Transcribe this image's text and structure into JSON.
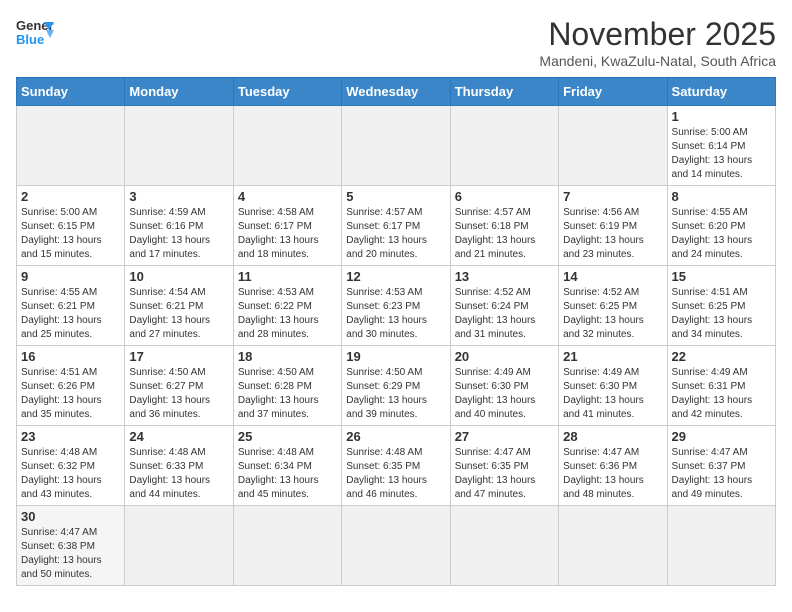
{
  "logo": {
    "text_general": "General",
    "text_blue": "Blue"
  },
  "title": "November 2025",
  "location": "Mandeni, KwaZulu-Natal, South Africa",
  "weekdays": [
    "Sunday",
    "Monday",
    "Tuesday",
    "Wednesday",
    "Thursday",
    "Friday",
    "Saturday"
  ],
  "weeks": [
    [
      {
        "day": "",
        "info": ""
      },
      {
        "day": "",
        "info": ""
      },
      {
        "day": "",
        "info": ""
      },
      {
        "day": "",
        "info": ""
      },
      {
        "day": "",
        "info": ""
      },
      {
        "day": "",
        "info": ""
      },
      {
        "day": "1",
        "info": "Sunrise: 5:00 AM\nSunset: 6:14 PM\nDaylight: 13 hours and 14 minutes."
      }
    ],
    [
      {
        "day": "2",
        "info": "Sunrise: 5:00 AM\nSunset: 6:15 PM\nDaylight: 13 hours and 15 minutes."
      },
      {
        "day": "3",
        "info": "Sunrise: 4:59 AM\nSunset: 6:16 PM\nDaylight: 13 hours and 17 minutes."
      },
      {
        "day": "4",
        "info": "Sunrise: 4:58 AM\nSunset: 6:17 PM\nDaylight: 13 hours and 18 minutes."
      },
      {
        "day": "5",
        "info": "Sunrise: 4:57 AM\nSunset: 6:17 PM\nDaylight: 13 hours and 20 minutes."
      },
      {
        "day": "6",
        "info": "Sunrise: 4:57 AM\nSunset: 6:18 PM\nDaylight: 13 hours and 21 minutes."
      },
      {
        "day": "7",
        "info": "Sunrise: 4:56 AM\nSunset: 6:19 PM\nDaylight: 13 hours and 23 minutes."
      },
      {
        "day": "8",
        "info": "Sunrise: 4:55 AM\nSunset: 6:20 PM\nDaylight: 13 hours and 24 minutes."
      }
    ],
    [
      {
        "day": "9",
        "info": "Sunrise: 4:55 AM\nSunset: 6:21 PM\nDaylight: 13 hours and 25 minutes."
      },
      {
        "day": "10",
        "info": "Sunrise: 4:54 AM\nSunset: 6:21 PM\nDaylight: 13 hours and 27 minutes."
      },
      {
        "day": "11",
        "info": "Sunrise: 4:53 AM\nSunset: 6:22 PM\nDaylight: 13 hours and 28 minutes."
      },
      {
        "day": "12",
        "info": "Sunrise: 4:53 AM\nSunset: 6:23 PM\nDaylight: 13 hours and 30 minutes."
      },
      {
        "day": "13",
        "info": "Sunrise: 4:52 AM\nSunset: 6:24 PM\nDaylight: 13 hours and 31 minutes."
      },
      {
        "day": "14",
        "info": "Sunrise: 4:52 AM\nSunset: 6:25 PM\nDaylight: 13 hours and 32 minutes."
      },
      {
        "day": "15",
        "info": "Sunrise: 4:51 AM\nSunset: 6:25 PM\nDaylight: 13 hours and 34 minutes."
      }
    ],
    [
      {
        "day": "16",
        "info": "Sunrise: 4:51 AM\nSunset: 6:26 PM\nDaylight: 13 hours and 35 minutes."
      },
      {
        "day": "17",
        "info": "Sunrise: 4:50 AM\nSunset: 6:27 PM\nDaylight: 13 hours and 36 minutes."
      },
      {
        "day": "18",
        "info": "Sunrise: 4:50 AM\nSunset: 6:28 PM\nDaylight: 13 hours and 37 minutes."
      },
      {
        "day": "19",
        "info": "Sunrise: 4:50 AM\nSunset: 6:29 PM\nDaylight: 13 hours and 39 minutes."
      },
      {
        "day": "20",
        "info": "Sunrise: 4:49 AM\nSunset: 6:30 PM\nDaylight: 13 hours and 40 minutes."
      },
      {
        "day": "21",
        "info": "Sunrise: 4:49 AM\nSunset: 6:30 PM\nDaylight: 13 hours and 41 minutes."
      },
      {
        "day": "22",
        "info": "Sunrise: 4:49 AM\nSunset: 6:31 PM\nDaylight: 13 hours and 42 minutes."
      }
    ],
    [
      {
        "day": "23",
        "info": "Sunrise: 4:48 AM\nSunset: 6:32 PM\nDaylight: 13 hours and 43 minutes."
      },
      {
        "day": "24",
        "info": "Sunrise: 4:48 AM\nSunset: 6:33 PM\nDaylight: 13 hours and 44 minutes."
      },
      {
        "day": "25",
        "info": "Sunrise: 4:48 AM\nSunset: 6:34 PM\nDaylight: 13 hours and 45 minutes."
      },
      {
        "day": "26",
        "info": "Sunrise: 4:48 AM\nSunset: 6:35 PM\nDaylight: 13 hours and 46 minutes."
      },
      {
        "day": "27",
        "info": "Sunrise: 4:47 AM\nSunset: 6:35 PM\nDaylight: 13 hours and 47 minutes."
      },
      {
        "day": "28",
        "info": "Sunrise: 4:47 AM\nSunset: 6:36 PM\nDaylight: 13 hours and 48 minutes."
      },
      {
        "day": "29",
        "info": "Sunrise: 4:47 AM\nSunset: 6:37 PM\nDaylight: 13 hours and 49 minutes."
      }
    ],
    [
      {
        "day": "30",
        "info": "Sunrise: 4:47 AM\nSunset: 6:38 PM\nDaylight: 13 hours and 50 minutes."
      },
      {
        "day": "",
        "info": ""
      },
      {
        "day": "",
        "info": ""
      },
      {
        "day": "",
        "info": ""
      },
      {
        "day": "",
        "info": ""
      },
      {
        "day": "",
        "info": ""
      },
      {
        "day": "",
        "info": ""
      }
    ]
  ]
}
